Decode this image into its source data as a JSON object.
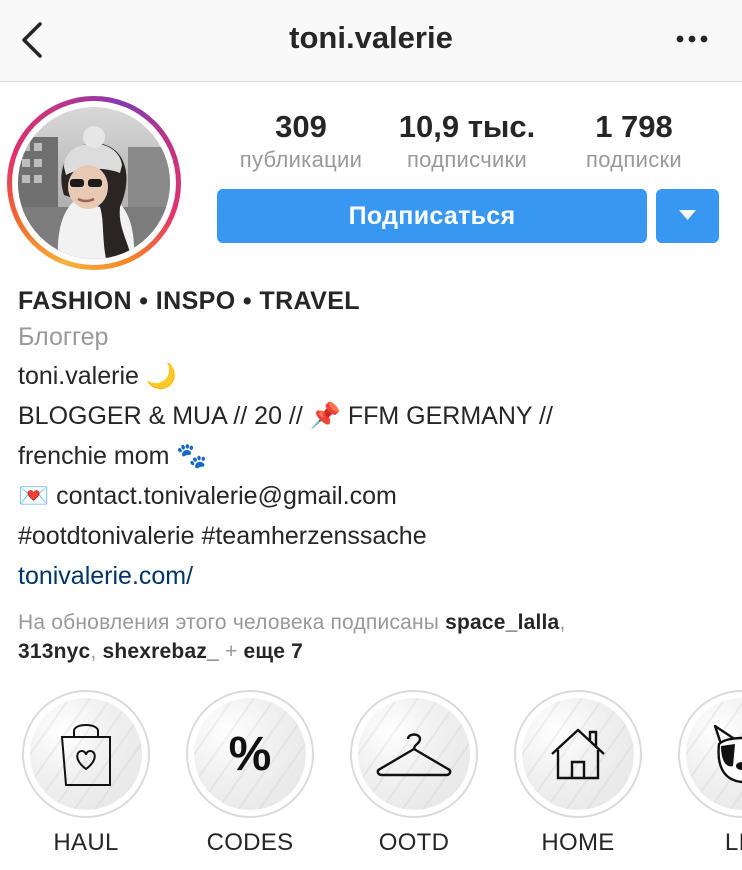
{
  "header": {
    "title": "toni.valerie",
    "back_icon": "chevron-left-icon",
    "more_icon": "ellipsis-icon"
  },
  "stats": [
    {
      "value": "309",
      "label": "публикации"
    },
    {
      "value": "10,9 тыс.",
      "label": "подписчики"
    },
    {
      "value": "1 798",
      "label": "подписки"
    }
  ],
  "actions": {
    "follow_label": "Подписаться",
    "dropdown_icon": "caret-down-icon"
  },
  "bio": {
    "name": "FASHION • INSPO • TRAVEL",
    "category": "Блоггер",
    "lines": [
      "toni.valerie 🌙",
      "BLOGGER & MUA // 20 // 📌 FFM GERMANY //",
      "frenchie mom 🐾",
      "💌 contact.tonivalerie@gmail.com",
      "#ootdtonivalerie #teamherzenssache"
    ],
    "link": "tonivalerie.com/"
  },
  "followed_by": {
    "prefix": "На обновления этого человека подписаны ",
    "user1": "space_lalla",
    "sep1": ",",
    "user2": "313nyc",
    "sep2": ", ",
    "user3": "shexrebaz_",
    "plus": " + ",
    "more": "еще 7"
  },
  "highlights": [
    {
      "label": "HAUL",
      "icon": "shopping-bag-heart-icon"
    },
    {
      "label": "CODES",
      "icon": "percent-icon"
    },
    {
      "label": "OOTD",
      "icon": "hanger-icon"
    },
    {
      "label": "HOME",
      "icon": "house-icon"
    },
    {
      "label": "LIL",
      "icon": "french-bulldog-icon"
    }
  ],
  "colors": {
    "accent": "#3897f0",
    "text": "#262626",
    "muted": "#999999",
    "link": "#003569"
  }
}
